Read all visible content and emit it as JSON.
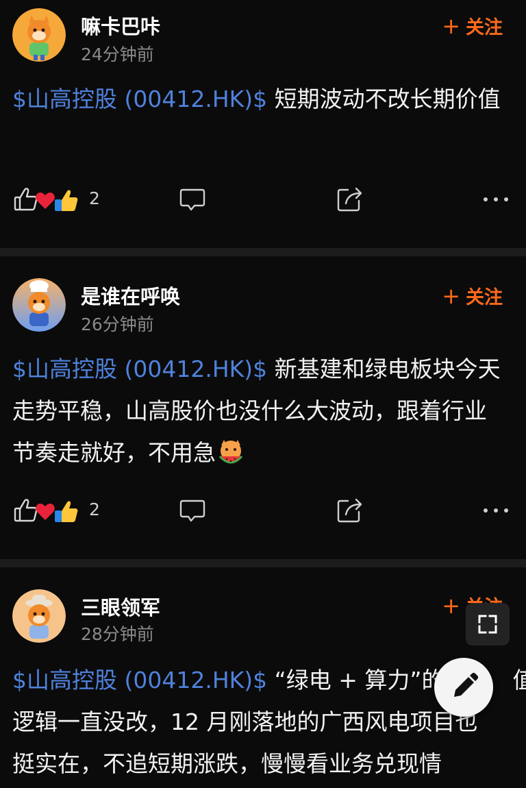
{
  "posts": [
    {
      "username": "嘛卡巴咔",
      "timestamp": "24分钟前",
      "follow_label": "关注",
      "ticker": "$山高控股 (00412.HK)$",
      "text": " 短期波动不改长期价值",
      "reaction_count": "2"
    },
    {
      "username": "是谁在呼唤",
      "timestamp": "26分钟前",
      "follow_label": "关注",
      "ticker": "$山高控股 (00412.HK)$",
      "text": " 新基建和绿电板块今天走势平稳，山高股价也没什么大波动，跟着行业节奏走就好，不用急",
      "reaction_count": "2"
    },
    {
      "username": "三眼领军",
      "timestamp": "28分钟前",
      "follow_label": "关注",
      "ticker": "$山高控股 (00412.HK)$",
      "text_line1": "“绿电 + 算力”的",
      "text_line1_tail": "值",
      "text_line2": "逻辑一直没改，12 月刚落地的广西风电项目也",
      "text_line3": "挺实在，不追短期涨跌，慢慢看业务兑现情"
    }
  ],
  "icons": {
    "follow": "plus-icon",
    "like": "thumbs-up-icon",
    "heart": "heart-icon",
    "clap": "thumbs-up-emoji-icon",
    "comment": "comment-icon",
    "share": "share-icon",
    "more": "more-icon",
    "fullscreen": "fullscreen-icon",
    "edit": "pencil-icon"
  },
  "colors": {
    "ticker": "#4f82dd",
    "follow": "#ff6a1a",
    "background": "#0b0b0b",
    "divider": "#1c1c1c"
  }
}
